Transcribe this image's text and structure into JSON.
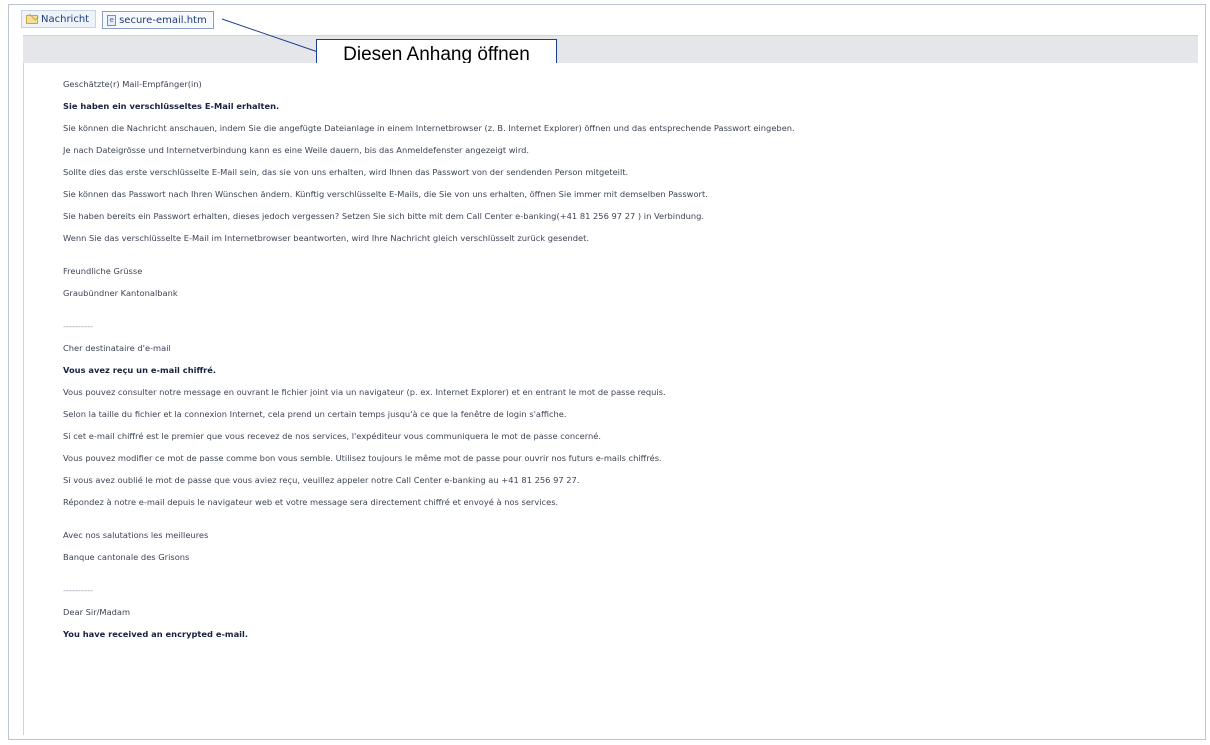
{
  "tabs": {
    "message_label": "Nachricht",
    "attachment_label": "secure-email.htm"
  },
  "callout": {
    "text": "Diesen Anhang öffnen"
  },
  "message": {
    "de": {
      "salutation": "Geschätzte(r) Mail-Empfänger(in)",
      "heading": "Sie haben ein verschlüsseltes E-Mail erhalten.",
      "p1": "Sie können die Nachricht anschauen, indem Sie die angefügte Dateianlage in einem Internetbrowser (z. B. Internet Explorer) öffnen und das entsprechende Passwort eingeben.",
      "p2": "Je nach Dateigrösse und Internetverbindung kann es eine Weile dauern, bis das Anmeldefenster angezeigt wird.",
      "p3": "Sollte dies das erste verschlüsselte E-Mail sein, das sie von uns erhalten, wird Ihnen das Passwort von der sendenden Person mitgeteilt.",
      "p4": "Sie können das Passwort nach Ihren Wünschen ändern. Künftig verschlüsselte E-Mails, die Sie von uns erhalten, öffnen Sie immer mit demselben Passwort.",
      "p5": "Sie haben bereits ein Passwort erhalten, dieses jedoch vergessen? Setzen Sie sich bitte mit dem Call Center e-banking(+41 81 256 97 27 ) in Verbindung.",
      "p6": "Wenn Sie das verschlüsselte E-Mail im Internetbrowser beantworten, wird Ihre Nachricht gleich verschlüsselt zurück gesendet.",
      "closing": "Freundliche Grüsse",
      "sender": "Graubündner Kantonalbank"
    },
    "separator": "----------",
    "fr": {
      "salutation": "Cher destinataire d'e-mail",
      "heading": "Vous avez reçu un e-mail chiffré.",
      "p1": "Vous pouvez consulter notre message en ouvrant le fichier joint via un navigateur (p. ex. Internet Explorer) et en entrant le mot de passe requis.",
      "p2": "Selon la taille du fichier et la connexion Internet, cela prend un certain temps jusqu'à ce que la fenêtre de login s'affiche.",
      "p3": "Si cet e-mail chiffré est le premier que vous recevez de nos services, l'expéditeur vous communiquera le mot de passe concerné.",
      "p4": "Vous pouvez modifier ce mot de passe comme bon vous semble. Utilisez toujours le même mot de passe pour ouvrir nos futurs e-mails chiffrés.",
      "p5": "Si vous avez oublié le mot de passe que vous aviez reçu, veuillez appeler notre Call Center e-banking au +41 81 256 97 27.",
      "p6": "Répondez à notre e-mail depuis le navigateur web et votre message sera directement chiffré et envoyé à nos services.",
      "closing": "Avec nos salutations les meilleures",
      "sender": "Banque cantonale des Grisons"
    },
    "en": {
      "salutation": "Dear Sir/Madam",
      "heading": "You have received an encrypted e-mail."
    }
  }
}
